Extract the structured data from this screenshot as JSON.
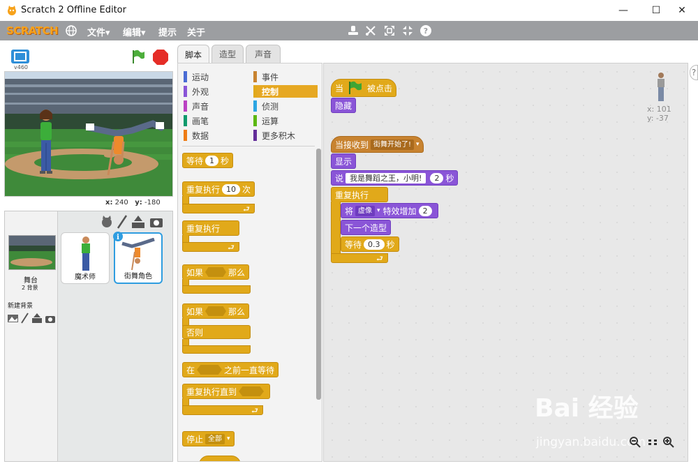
{
  "window": {
    "title": "Scratch 2 Offline Editor",
    "minimize_glyph": "—",
    "maximize_glyph": "☐",
    "close_glyph": "✕"
  },
  "menubar": {
    "logo": "SCRATCH",
    "items": [
      "文件▾",
      "编辑▾",
      "提示",
      "关于"
    ]
  },
  "stage": {
    "version": "v460",
    "coord_x_label": "x:",
    "coord_x": "240",
    "coord_y_label": "y:",
    "coord_y": "-180"
  },
  "sprites": {
    "stage_label": "舞台",
    "stage_backdrops": "2 背景",
    "new_backdrop_label": "新建背景",
    "list": [
      {
        "name": "魔术师",
        "selected": false
      },
      {
        "name": "街舞角色",
        "selected": true
      }
    ]
  },
  "tabs": [
    "脚本",
    "造型",
    "声音"
  ],
  "categories": [
    {
      "label": "运动",
      "color": "#4a6cd4"
    },
    {
      "label": "事件",
      "color": "#c88330"
    },
    {
      "label": "外观",
      "color": "#8a55d7"
    },
    {
      "label": "控制",
      "color": "#e1a91a",
      "active": true
    },
    {
      "label": "声音",
      "color": "#bb42c3"
    },
    {
      "label": "侦测",
      "color": "#2ca5e2"
    },
    {
      "label": "画笔",
      "color": "#0e9a6c"
    },
    {
      "label": "运算",
      "color": "#5cb712"
    },
    {
      "label": "数据",
      "color": "#ee7d16"
    },
    {
      "label": "更多积木",
      "color": "#632d99"
    }
  ],
  "palette_blocks": {
    "wait": {
      "label": "等待",
      "value": "1",
      "unit": "秒"
    },
    "repeat": {
      "label": "重复执行",
      "value": "10",
      "unit": "次"
    },
    "forever": {
      "label": "重复执行"
    },
    "if_then": {
      "if": "如果",
      "then": "那么"
    },
    "if_else": {
      "if": "如果",
      "then": "那么",
      "else": "否则"
    },
    "wait_until": {
      "before": "在",
      "after": "之前一直等待"
    },
    "repeat_until": {
      "label": "重复执行直到"
    },
    "stop": {
      "label": "停止",
      "option": "全部"
    }
  },
  "script1": {
    "hat_when": "当",
    "hat_clicked": "被点击",
    "hide": "隐藏"
  },
  "script2": {
    "hat": "当接收到",
    "hat_message": "街舞开始了!",
    "show": "显示",
    "say": "说",
    "say_text": "我是舞蹈之王，小明!",
    "say_secs": "2",
    "say_unit": "秒",
    "forever": "重复执行",
    "change_prefix": "将",
    "change_effect": "虚像",
    "change_suffix": "特效增加",
    "change_value": "2",
    "next_costume": "下一个造型",
    "wait": "等待",
    "wait_value": "0.3",
    "wait_unit": "秒"
  },
  "sprite_info": {
    "x_label": "x:",
    "x": "101",
    "y_label": "y:",
    "y": "-37"
  },
  "watermark": {
    "brand": "Bai 经验",
    "url": "jingyan.baidu.com"
  },
  "colors": {
    "menubar": "#9c9ea1",
    "control": "#e1a91a",
    "looks": "#8a55d7",
    "selected": "#2f9de0"
  }
}
